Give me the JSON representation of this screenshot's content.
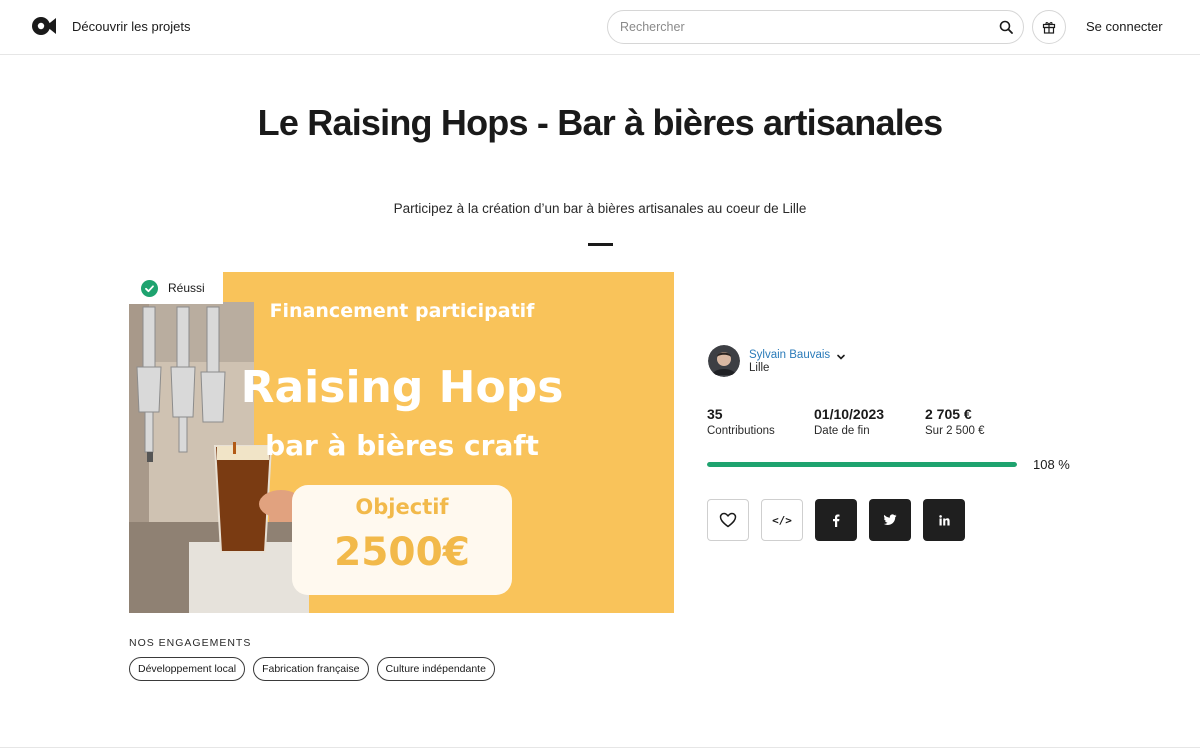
{
  "header": {
    "discover_label": "Découvrir les projets",
    "search_placeholder": "Rechercher",
    "login_label": "Se connecter"
  },
  "project": {
    "title": "Le Raising Hops - Bar à bières artisanales",
    "subtitle": "Participez à la création d’un bar à bières artisanales au coeur de Lille",
    "status": "Réussi",
    "image_text": {
      "headline_top": "Financement participatif",
      "headline_main": "Raising Hops",
      "headline_sub": "bar à bières craft",
      "goal_label": "Objectif",
      "goal_value": "2500€"
    }
  },
  "engagements": {
    "heading": "NOS ENGAGEMENTS",
    "tags": [
      "Développement local",
      "Fabrication française",
      "Culture indépendante"
    ]
  },
  "owner": {
    "name": "Sylvain Bauvais",
    "city": "Lille"
  },
  "stats": {
    "contributions_value": "35",
    "contributions_label": "Contributions",
    "end_date_value": "01/10/2023",
    "end_date_label": "Date de fin",
    "raised_value": "2 705 €",
    "raised_label": "Sur 2 500 €",
    "progress_percent": 108,
    "progress_label": "108 %"
  },
  "actions": {
    "like_icon": "heart-icon",
    "embed_label": "</>",
    "share_icons": [
      "facebook-icon",
      "twitter-icon",
      "linkedin-icon"
    ]
  },
  "colors": {
    "accent_green": "#1ea36f",
    "owner_link": "#2b7bb9",
    "image_yellow": "#f9c35a"
  }
}
